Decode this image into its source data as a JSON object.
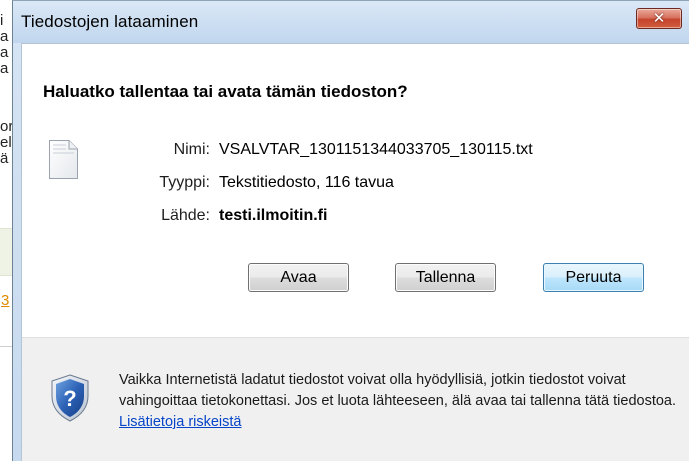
{
  "background_page": {
    "fragments": [
      "i",
      "a",
      "a",
      "a",
      "or",
      "el",
      "ä"
    ],
    "link_fragment": "3"
  },
  "dialog": {
    "title": "Tiedostojen lataaminen",
    "close_icon": "close-x-icon",
    "question": "Haluatko tallentaa tai avata tämän tiedoston?",
    "file_icon": "text-document-icon",
    "fields": {
      "name_label": "Nimi:",
      "name_value": "VSALVTAR_1301151344033705_130115.txt",
      "type_label": "Tyyppi:",
      "type_value": "Tekstitiedosto, 116 tavua",
      "source_label": "Lähde:",
      "source_value": "testi.ilmoitin.fi"
    },
    "buttons": {
      "open": "Avaa",
      "save": "Tallenna",
      "cancel": "Peruuta"
    },
    "warning": {
      "icon": "security-shield-icon",
      "text": "Vaikka Internetistä ladatut tiedostot voivat olla hyödyllisiä, jotkin tiedostot voivat vahingoittaa tietokonettasi. Jos et luota lähteeseen, älä avaa tai tallenna tätä tiedostoa.",
      "link": "Lisätietoja riskeistä"
    }
  },
  "colors": {
    "titlebar": "#c6d9ef",
    "close_button": "#c4442c",
    "default_button_border": "#3c7fb1",
    "link": "#0645c8",
    "warning_background": "#f0f0f0"
  }
}
